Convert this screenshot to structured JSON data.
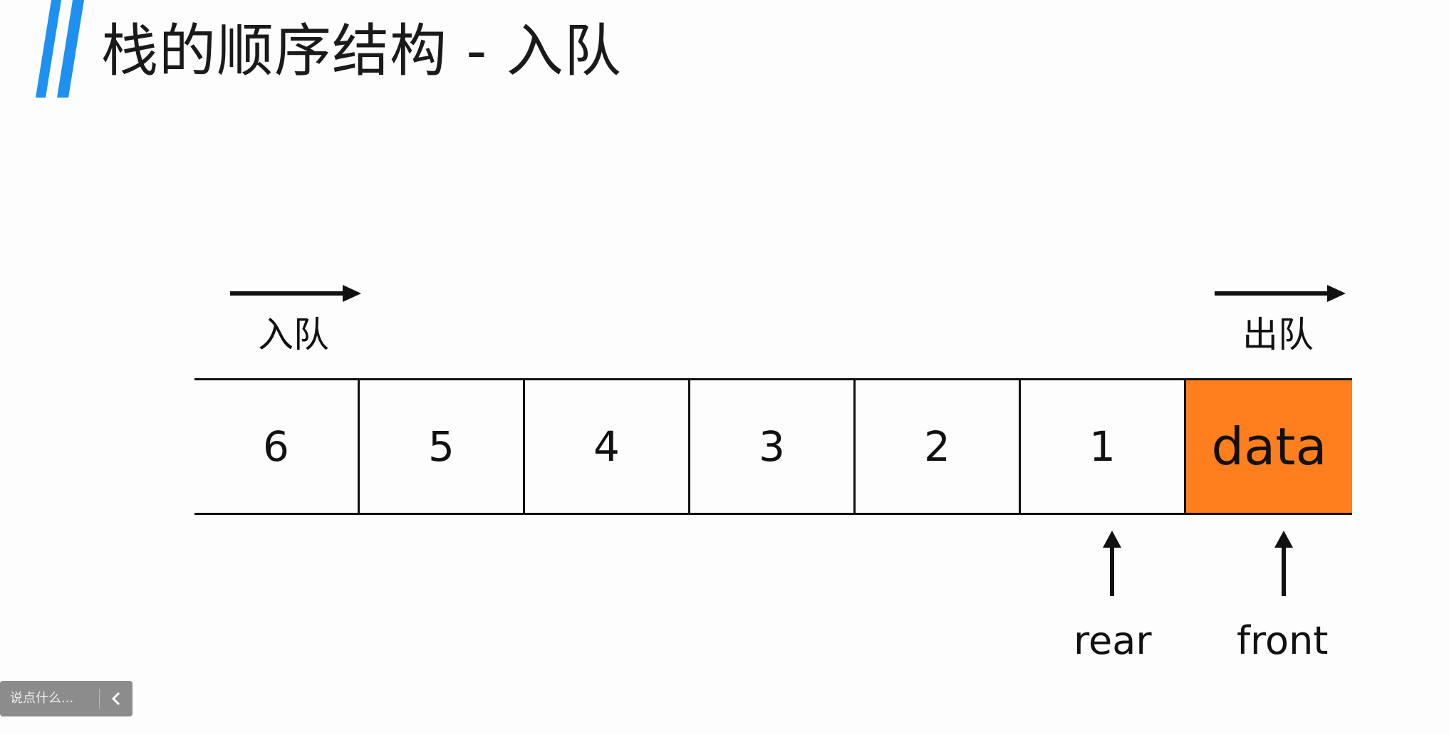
{
  "slide": {
    "title": "栈的顺序结构 - 入队",
    "accent_color": "#1e90f0"
  },
  "diagram": {
    "enqueue_label": "入队",
    "dequeue_label": "出队",
    "cells": [
      "6",
      "5",
      "4",
      "3",
      "2",
      "1",
      "data"
    ],
    "highlight_color": "#ff7f1e",
    "rear_label": "rear",
    "front_label": "front"
  },
  "chat": {
    "placeholder": "说点什么...",
    "toggle_icon": "chevron-left-icon"
  }
}
